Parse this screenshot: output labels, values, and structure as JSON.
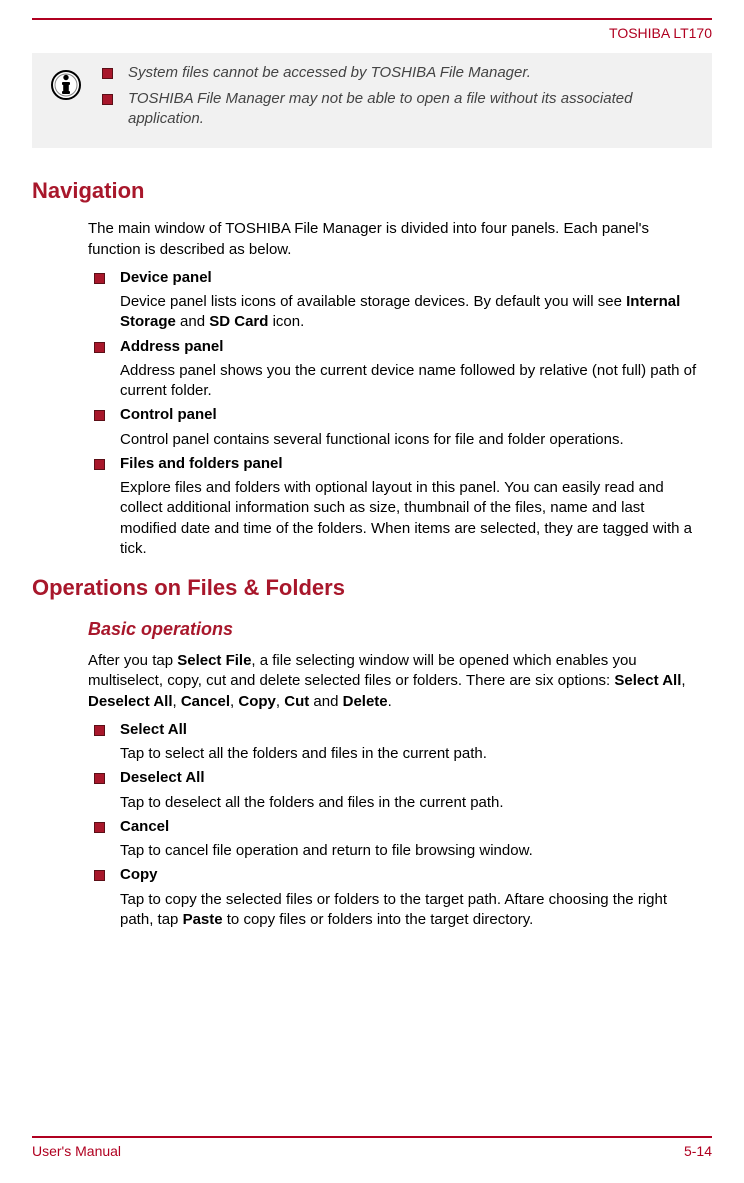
{
  "header": {
    "product": "TOSHIBA LT170"
  },
  "info": {
    "notes": [
      "System files cannot be accessed by TOSHIBA File Manager.",
      "TOSHIBA File Manager may not be able to open a file without its associated application."
    ]
  },
  "nav": {
    "heading": "Navigation",
    "intro": "The main window of TOSHIBA File Manager is divided into four panels. Each panel's function is described as below.",
    "items": [
      {
        "title": "Device panel",
        "desc_pre": "Device panel lists icons of available storage devices. By default you will see ",
        "bold1": "Internal Storage",
        "mid": " and ",
        "bold2": "SD Card",
        "desc_post": " icon."
      },
      {
        "title": "Address panel",
        "desc": "Address panel shows you the current device name followed by relative (not full) path of current folder."
      },
      {
        "title": "Control panel",
        "desc": "Control panel contains several functional icons for file and folder operations."
      },
      {
        "title": "Files and folders panel",
        "desc": "Explore files and folders with optional layout in this panel. You can easily read and collect additional information such as size, thumbnail of the files, name and last modified date and time of the folders. When items are selected, they are tagged with a tick."
      }
    ]
  },
  "ops": {
    "heading": "Operations on Files & Folders",
    "sub": "Basic operations",
    "intro_pre": "After you tap ",
    "intro_b1": "Select File",
    "intro_mid1": ", a file selecting window will be opened which enables you multiselect, copy, cut and delete selected files or folders. There are six options: ",
    "intro_b2": "Select All",
    "sep1": ", ",
    "intro_b3": "Deselect All",
    "sep2": ", ",
    "intro_b4": "Cancel",
    "sep3": ", ",
    "intro_b5": "Copy",
    "sep4": ", ",
    "intro_b6": "Cut",
    "sep5": " and ",
    "intro_b7": "Delete",
    "intro_post": ".",
    "items": [
      {
        "title": "Select All",
        "desc": "Tap to select all the folders and files in the current path."
      },
      {
        "title": "Deselect All",
        "desc": "Tap to deselect all the folders and files in the current path."
      },
      {
        "title": "Cancel",
        "desc": "Tap to cancel file operation and return to file browsing window."
      },
      {
        "title": "Copy",
        "desc_pre": "Tap to copy the selected files or folders to the target path. Aftare choosing the right path, tap ",
        "bold1": "Paste",
        "desc_post": " to copy files or folders into the target directory."
      }
    ]
  },
  "footer": {
    "left": "User's Manual",
    "right": "5-14"
  }
}
